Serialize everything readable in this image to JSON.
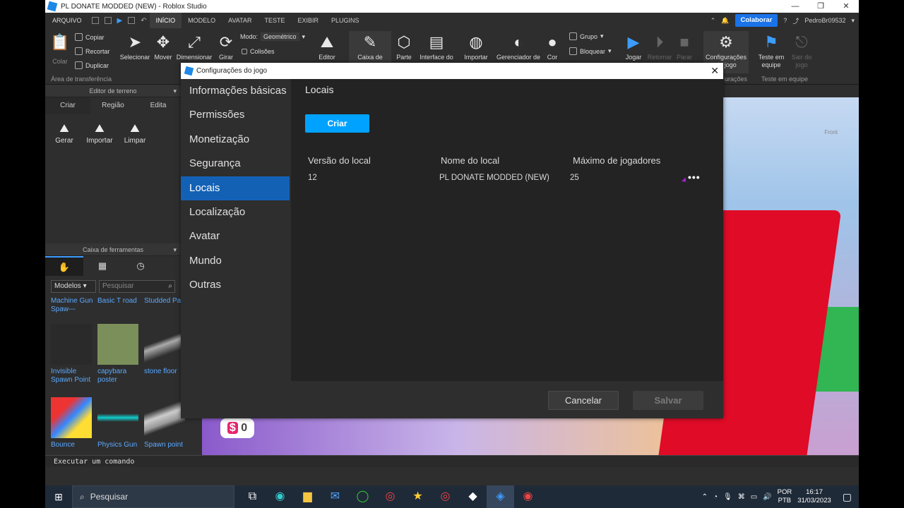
{
  "window": {
    "title": "PL DONATE MODDED (NEW) - Roblox Studio",
    "min": "—",
    "restore": "❐",
    "close": "✕"
  },
  "menu": {
    "file": "ARQUIVO",
    "tabs": [
      "INÍCIO",
      "MODELO",
      "AVATAR",
      "TESTE",
      "EXIBIR",
      "PLUGINS"
    ],
    "collaborate": "Colaborar",
    "user": "PedroBr09532"
  },
  "ribbon": {
    "clipboard": {
      "paste": "Colar",
      "copy": "Copiar",
      "cut": "Recortar",
      "duplicate": "Duplicar",
      "group": "Área de transferência"
    },
    "tools": {
      "select": "Selecionar",
      "move": "Mover",
      "scale": "Dimensionar",
      "rotate": "Girar",
      "mode_label": "Modo:",
      "mode_value": "Geométrico",
      "collisions": "Colisões"
    },
    "editor": "Editor",
    "toolbox": "Caixa de",
    "part": "Parte",
    "ui": "Interface do",
    "import": "Importar",
    "material": "Gerenciador de",
    "color": "Cor",
    "group": "Grupo",
    "lock": "Bloquear",
    "play": "Jogar",
    "resume": "Retomar",
    "stop": "Parar",
    "game_settings": "Configurações do jogo",
    "settings_group": "urações",
    "team_test": "Teste em equipe",
    "exit_game": "Sair do jogo",
    "team_test_group": "Teste em equipe"
  },
  "terrain": {
    "title": "Editor de terreno",
    "tabs": [
      "Criar",
      "Região",
      "Edita"
    ],
    "tools": [
      "Gerar",
      "Importar",
      "Limpar"
    ]
  },
  "toolbox": {
    "title": "Caixa de ferramentas",
    "category": "Modelos",
    "search_placeholder": "Pesquisar",
    "items": [
      "Machine Gun Spaw---",
      "Basic T road",
      "Studded Part",
      "Invisible Spawn Point",
      "capybara poster",
      "stone floor",
      "Bounce",
      "Physics Gun",
      "Spawn point"
    ]
  },
  "viewport": {
    "money": "0",
    "front_label": "Front"
  },
  "command": {
    "placeholder": "Executar um comando"
  },
  "dialog": {
    "title": "Configurações do jogo",
    "nav": [
      "Informações básicas",
      "Permissões",
      "Monetização",
      "Segurança",
      "Locais",
      "Localização",
      "Avatar",
      "Mundo",
      "Outras"
    ],
    "active_index": 4,
    "heading": "Locais",
    "create_button": "Criar",
    "columns": [
      "Versão do local",
      "Nome do local",
      "Máximo de jogadores"
    ],
    "rows": [
      {
        "version": "12",
        "name": "PL DONATE MODDED (NEW)",
        "max_players": "25"
      }
    ],
    "more": "•••",
    "cancel": "Cancelar",
    "save": "Salvar"
  },
  "taskbar": {
    "search": "Pesquisar",
    "lang": "POR",
    "lang2": "PTB",
    "time": "16:17",
    "date": "31/03/2023"
  },
  "colors": {
    "accent": "#00a2ff",
    "nav_selected": "#1361b5",
    "collab": "#1a73e8"
  }
}
